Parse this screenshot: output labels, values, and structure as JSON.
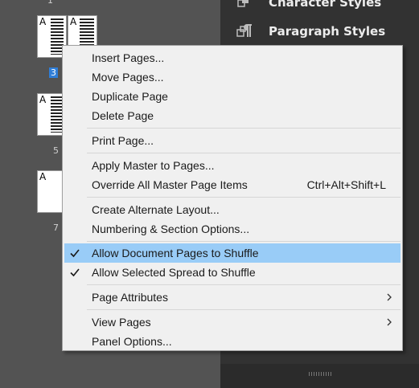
{
  "styles_panel": {
    "rows": [
      {
        "label": "Character Styles"
      },
      {
        "label": "Paragraph Styles"
      }
    ]
  },
  "pages_panel": {
    "page_numbers": [
      "1",
      "3",
      "5",
      "7"
    ],
    "selected_page": "3",
    "thumb_letter": "A"
  },
  "context_menu": {
    "groups": [
      [
        {
          "label": "Insert Pages..."
        },
        {
          "label": "Move Pages..."
        },
        {
          "label": "Duplicate Page"
        },
        {
          "label": "Delete Page"
        }
      ],
      [
        {
          "label": "Print Page..."
        }
      ],
      [
        {
          "label": "Apply Master to Pages..."
        },
        {
          "label": "Override All Master Page Items",
          "shortcut": "Ctrl+Alt+Shift+L"
        }
      ],
      [
        {
          "label": "Create Alternate Layout..."
        },
        {
          "label": "Numbering & Section Options..."
        }
      ],
      [
        {
          "label": "Allow Document Pages to Shuffle",
          "checked": true,
          "highlighted": true
        },
        {
          "label": "Allow Selected Spread to Shuffle",
          "checked": true
        }
      ],
      [
        {
          "label": "Page Attributes",
          "submenu": true
        }
      ],
      [
        {
          "label": "View Pages",
          "submenu": true
        },
        {
          "label": "Panel Options..."
        }
      ]
    ]
  }
}
